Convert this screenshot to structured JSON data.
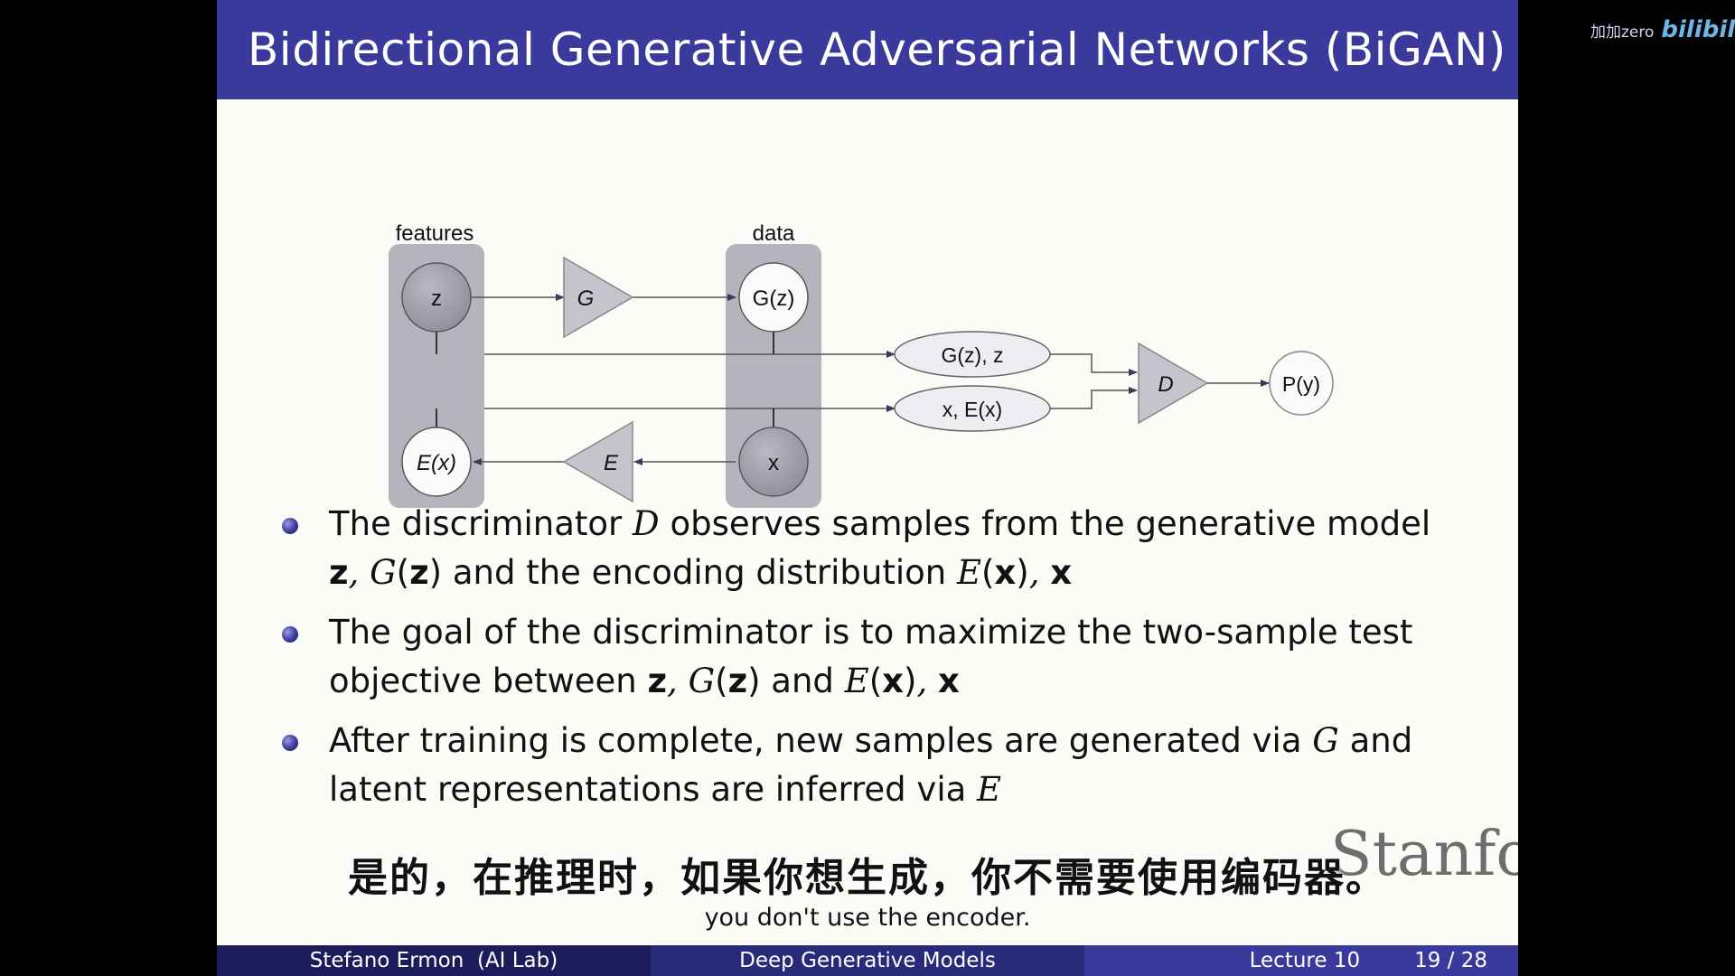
{
  "slide": {
    "title": "Bidirectional Generative Adversarial Networks (BiGAN)"
  },
  "diagram": {
    "features_label": "features",
    "data_label": "data",
    "z_label": "z",
    "g_label": "G",
    "gz_label": "G(z)",
    "ex_label": "E(x)",
    "e_label": "E",
    "x_label": "x",
    "pair1_label": "G(z), z",
    "pair2_label": "x, E(x)",
    "d_label": "D",
    "py_label": "P(y)"
  },
  "bullets": {
    "b1": {
      "t1": "The discriminator ",
      "m1": "D",
      "t2": " observes samples from the generative model",
      "l2_z": "z",
      "l2_sep1": ", ",
      "l2_G": "G",
      "l2_p1": "(",
      "l2_z2": "z",
      "l2_p2": ")",
      "l2_text": " and the encoding distribution ",
      "l2_E": "E",
      "l2_p3": "(",
      "l2_x": "x",
      "l2_p4": ")",
      "l2_sep2": ", ",
      "l2_x2": "x"
    },
    "b2": {
      "t1": "The goal of the discriminator is to maximize the two-sample test",
      "t2": "objective between ",
      "z": "z",
      "sep1": ", ",
      "G": "G",
      "p1": "(",
      "z2": "z",
      "p2": ")",
      "and": " and ",
      "E": "E",
      "p3": "(",
      "x": "x",
      "p4": ")",
      "sep2": ", ",
      "x2": "x"
    },
    "b3": {
      "t1": "After training is complete, new samples are generated via ",
      "G": "G",
      "t2": " and",
      "t3": "latent representations are inferred via ",
      "E": "E"
    }
  },
  "subtitles": {
    "chinese": "是的，在推理时，如果你想生成，你不需要使用编码器。",
    "english": "you don't use the encoder."
  },
  "branding": {
    "stanford": "Stanfor",
    "watermark_text": "加加zero",
    "watermark_logo": "bilibili"
  },
  "footer": {
    "author": "Stefano Ermon  (AI Lab)",
    "course": "Deep Generative Models",
    "lecture": "Lecture 10",
    "page": "19 / 28"
  },
  "colors": {
    "beamer_blue": "#3a3a9c",
    "footer_dark": "#1c1c5a",
    "footer_mid": "#2a2a7a",
    "node_gray": "#a8a8b3",
    "panel_gray": "#b4b4bd"
  }
}
